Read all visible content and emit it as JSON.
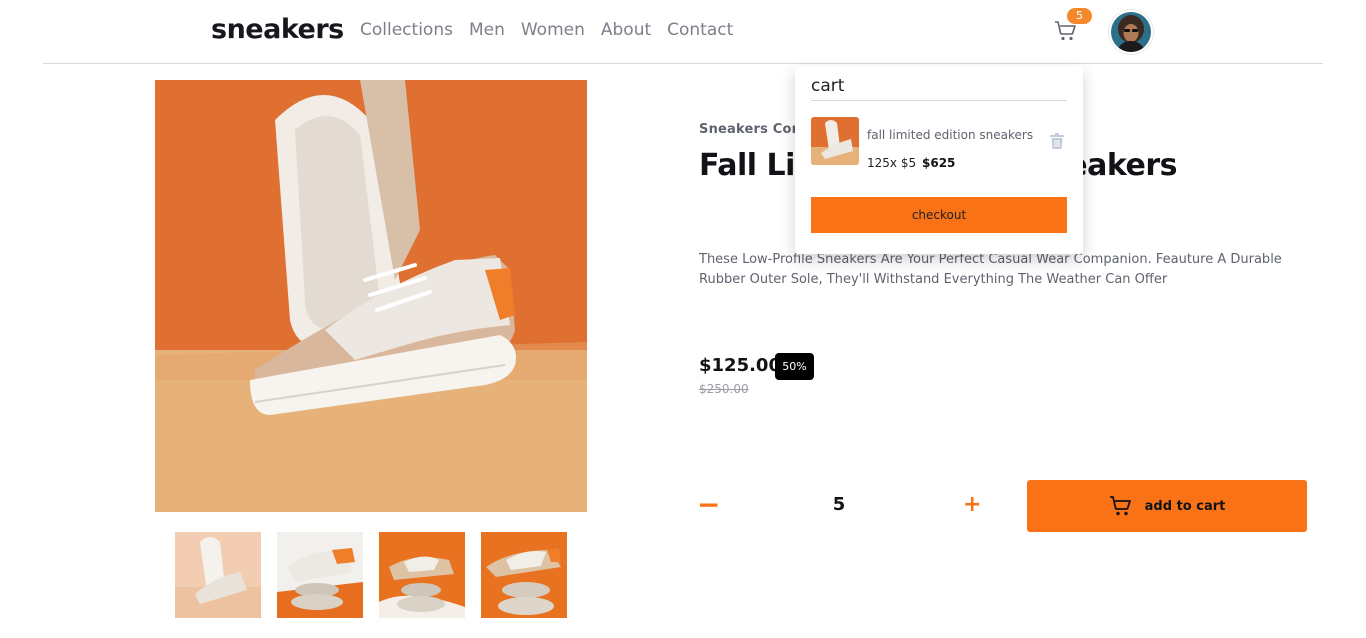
{
  "header": {
    "logo": "sneakers",
    "nav": [
      "Collections",
      "Men",
      "Women",
      "About",
      "Contact"
    ],
    "cart_count": "5"
  },
  "product": {
    "company": "Sneakers Company",
    "title": "Fall Limited Edition Sneakers",
    "description": "These Low-Profile Sneakers Are Your Perfect Casual Wear Companion. Feauture A Durable Rubber Outer Sole, They'll Withstand Everything The Weather Can Offer",
    "price": "$125.00",
    "discount": "50%",
    "old_price": "$250.00",
    "quantity": "5",
    "minus_label": "−",
    "plus_label": "+",
    "add_to_cart": "add to cart"
  },
  "cart": {
    "heading": "cart",
    "item_name": "fall limited edition sneakers",
    "item_calc": "125x $5",
    "item_total": "$625",
    "checkout": "checkout"
  },
  "colors": {
    "accent": "#f97316",
    "badge": "#f3882d",
    "main_bg": "#e07031",
    "floor": "#e4b27b"
  },
  "icons": [
    "cart-icon",
    "trash-icon",
    "avatar"
  ]
}
